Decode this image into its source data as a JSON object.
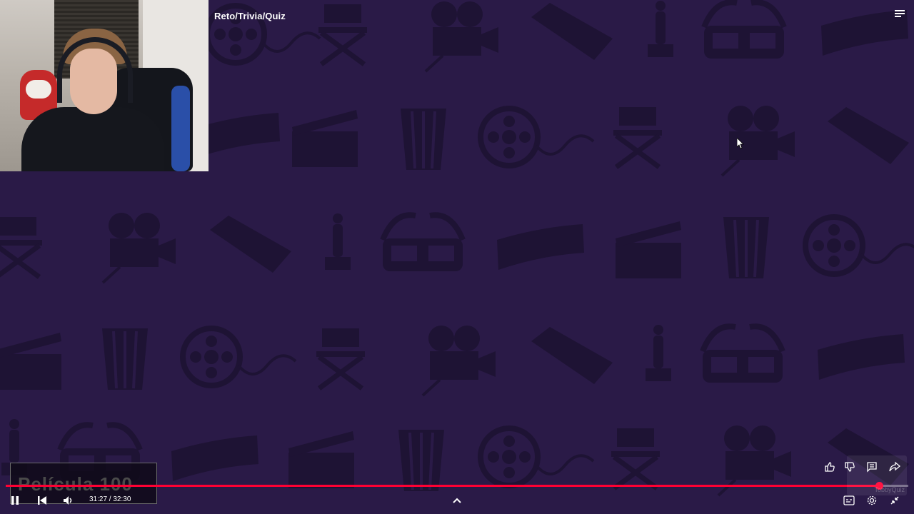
{
  "video": {
    "title": "Reto/Trivia/Quiz",
    "thumbnail_text": "Película 100",
    "time_display": "31:27 / 32:30",
    "progress_fraction": 0.968
  },
  "watermark": {
    "text": "TobbyQuiz"
  },
  "icons": {
    "playlist": "playlist-icon",
    "pause": "pause-icon",
    "previous": "skip-previous-icon",
    "volume": "volume-icon",
    "expand": "chevron-up-icon",
    "like": "thumbs-up-icon",
    "dislike": "thumbs-down-icon",
    "comments": "comment-icon",
    "share": "share-icon",
    "captions": "captions-icon",
    "settings": "gear-icon",
    "exit_fullscreen": "exit-fullscreen-icon"
  },
  "colors": {
    "background": "#2a1a47",
    "pattern": "#23163d",
    "progress": "#ff0033"
  }
}
